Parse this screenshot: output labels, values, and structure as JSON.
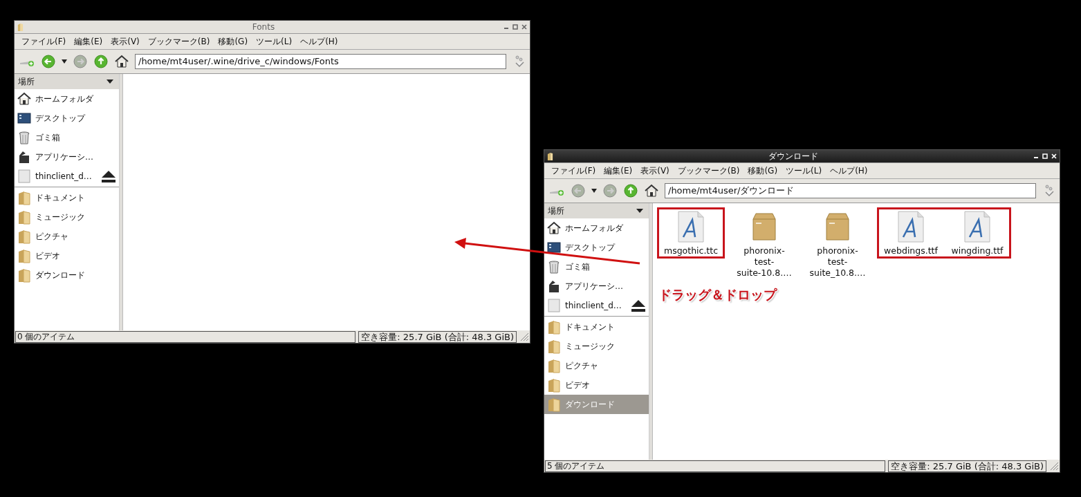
{
  "windows": [
    {
      "title": "Fonts",
      "active": false,
      "menu": [
        "ファイル(F)",
        "編集(E)",
        "表示(V)",
        "ブックマーク(B)",
        "移動(G)",
        "ツール(L)",
        "ヘルプ(H)"
      ],
      "back_disabled": false,
      "forward_disabled": true,
      "address": "/home/mt4user/.wine/drive_c/windows/Fonts",
      "places_header": "場所",
      "places": [
        {
          "kind": "home",
          "label": "ホームフォルダ"
        },
        {
          "kind": "desktop",
          "label": "デスクトップ"
        },
        {
          "kind": "trash",
          "label": "ゴミ箱"
        },
        {
          "kind": "apps",
          "label": "アプリケーシ…"
        },
        {
          "kind": "drive",
          "label": "thinclient_d…"
        }
      ],
      "bookmarks": [
        {
          "label": "ドキュメント",
          "selected": false
        },
        {
          "label": "ミュージック",
          "selected": false
        },
        {
          "label": "ピクチャ",
          "selected": false
        },
        {
          "label": "ビデオ",
          "selected": false
        },
        {
          "label": "ダウンロード",
          "selected": false
        }
      ],
      "status_left": "0 個のアイテム",
      "status_right": "空き容量: 25.7 GiB (合計: 48.3 GiB)"
    },
    {
      "title": "ダウンロード",
      "active": true,
      "menu": [
        "ファイル(F)",
        "編集(E)",
        "表示(V)",
        "ブックマーク(B)",
        "移動(G)",
        "ツール(L)",
        "ヘルプ(H)"
      ],
      "back_disabled": true,
      "forward_disabled": true,
      "address": "/home/mt4user/ダウンロード",
      "places_header": "場所",
      "places": [
        {
          "kind": "home",
          "label": "ホームフォルダ"
        },
        {
          "kind": "desktop",
          "label": "デスクトップ"
        },
        {
          "kind": "trash",
          "label": "ゴミ箱"
        },
        {
          "kind": "apps",
          "label": "アプリケーシ…"
        },
        {
          "kind": "drive",
          "label": "thinclient_d…"
        }
      ],
      "bookmarks": [
        {
          "label": "ドキュメント",
          "selected": false
        },
        {
          "label": "ミュージック",
          "selected": false
        },
        {
          "label": "ピクチャ",
          "selected": false
        },
        {
          "label": "ビデオ",
          "selected": false
        },
        {
          "label": "ダウンロード",
          "selected": true
        }
      ],
      "files": [
        {
          "kind": "font",
          "name": [
            "msgothic.ttc"
          ],
          "highlighted": true
        },
        {
          "kind": "package",
          "name": [
            "phoronix-",
            "test-",
            "suite-10.8.…"
          ],
          "highlighted": false
        },
        {
          "kind": "package",
          "name": [
            "phoronix-",
            "test-",
            "suite_10.8.…"
          ],
          "highlighted": false
        },
        {
          "kind": "font",
          "name": [
            "webdings.ttf"
          ],
          "highlighted": true
        },
        {
          "kind": "font",
          "name": [
            "wingding.ttf"
          ],
          "highlighted": true
        }
      ],
      "status_left": "5 個のアイテム",
      "status_right": "空き容量: 25.7 GiB (合計: 48.3 GiB)"
    }
  ],
  "annotation": {
    "text": "ドラッグ＆ドロップ"
  }
}
